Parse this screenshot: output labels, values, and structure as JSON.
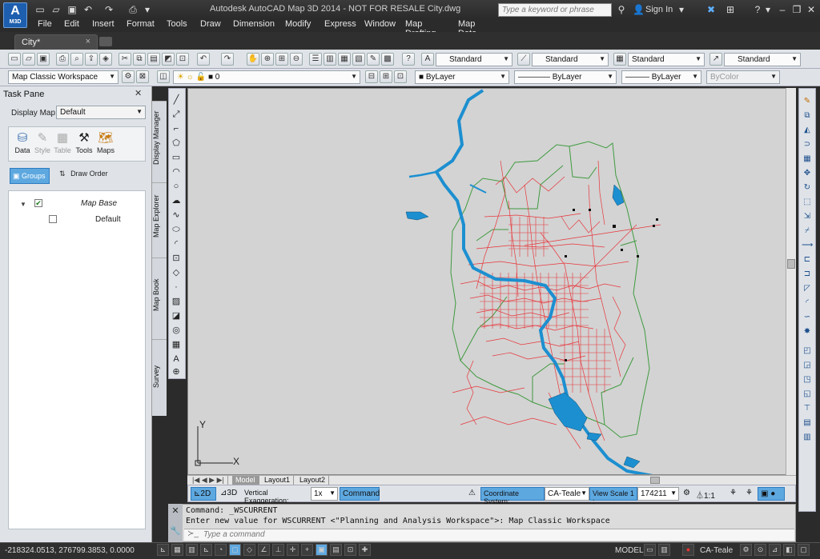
{
  "app": {
    "logo_letter": "A",
    "logo_label": "M3D",
    "title": "Autodesk AutoCAD Map 3D 2014 - NOT FOR RESALE   City.dwg"
  },
  "search": {
    "placeholder": "Type a keyword or phrase"
  },
  "header": {
    "sign_in": "Sign In"
  },
  "menu": [
    "File",
    "Edit",
    "Insert",
    "Format",
    "Tools",
    "Draw",
    "Dimension",
    "Modify",
    "Express",
    "Window",
    "Map Drafting",
    "Map Data and Analysis"
  ],
  "doc_tab": {
    "label": "City*",
    "close": "×"
  },
  "styles_toolbar": {
    "text_style": "Standard",
    "dim_style": "Standard",
    "table_style": "Standard",
    "mleader_style": "Standard"
  },
  "workspace": {
    "value": "Map Classic Workspace"
  },
  "layers": {
    "current_layer": "0",
    "color": "ByLayer",
    "linetype": "ByLayer",
    "lineweight": "ByLayer",
    "plot_style": "ByColor"
  },
  "task_pane": {
    "title": "Task Pane",
    "display_map_label": "Display Map:",
    "display_map_value": "Default",
    "icons": [
      "Data",
      "Style",
      "Table",
      "Tools",
      "Maps"
    ],
    "groups_label": "Groups",
    "draw_order_label": "Draw Order",
    "layers": [
      {
        "name": "Map Base",
        "checked": true
      },
      {
        "name": "Default",
        "checked": false
      }
    ],
    "side_tabs": [
      "Display Manager",
      "Map Explorer",
      "Map Book",
      "Survey"
    ]
  },
  "layout_tabs": [
    "Model",
    "Layout1",
    "Layout2"
  ],
  "map_status": {
    "view2d": "2D",
    "view3d": "3D",
    "vertical_exaggeration_label": "Vertical Exaggeration:",
    "vertical_exaggeration_value": "1x",
    "command_label": "Command",
    "coord_system_label": "Coordinate System:",
    "coord_system_value": "CA-Teale",
    "view_scale_label": "View Scale  1 :",
    "view_scale_value": "174211",
    "annotation_scale": "1:1"
  },
  "ucs": {
    "x": "X",
    "y": "Y"
  },
  "command": {
    "line1": "Command: _WSCURRENT",
    "line2": "Enter new value for WSCURRENT <\"Planning and Analysis Workspace\">: Map Classic Workspace",
    "placeholder": "Type a command"
  },
  "status_bar": {
    "coords": "-218324.0513, 276799.3853, 0.0000",
    "model": "MODEL",
    "coord_sys": "CA-Teale"
  },
  "colors": {
    "roads": "#e8353a",
    "boundaries": "#3f9a3f",
    "water": "#1c8fd0",
    "accent": "#5ea8e0"
  }
}
